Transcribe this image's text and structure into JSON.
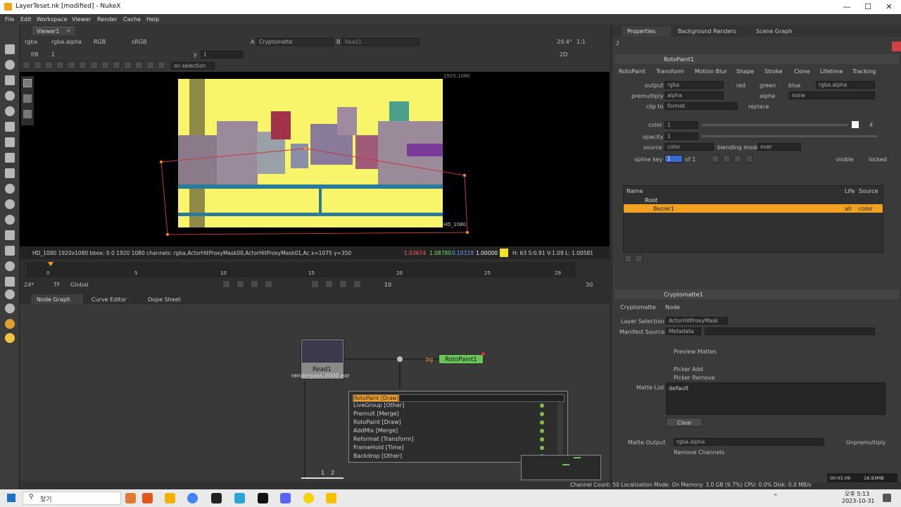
{
  "window": {
    "title": "LayerTeset.nk [modified] - NukeX"
  },
  "menu": [
    "File",
    "Edit",
    "Workspace",
    "Viewer",
    "Render",
    "Cache",
    "Help"
  ],
  "viewer": {
    "tab": "Viewer1",
    "channels": "rgba",
    "alpha": "rgba.alpha",
    "mode": "RGB",
    "lut": "sRGB",
    "input_a_label": "A",
    "input_a": "Cryptomatte",
    "input_b_label": "B",
    "input_b": "Read1",
    "zoom": "29.4°",
    "ratio": "1:1",
    "view_mode": "2D",
    "frame_field": "f/8",
    "frame_value": "1",
    "y_label": "y",
    "y_value": "1",
    "on_selection": "on selection",
    "resolution_label": "1920,1080",
    "format_label": "HD_1080",
    "info": "HD_1080 1920x1080  bbox: 0 0 1920 1080 channels: rgba,ActorHitProxyMask00,ActorHitProxyMask01,Ac  x=1075 y=350",
    "pixel_r": "1.03674",
    "pixel_g": "1.08780",
    "pixel_b": "0.10119",
    "pixel_a": "1.00000",
    "hsv": "H: 63 S:0.91 V:1.09  L: 1.00581"
  },
  "timeline": {
    "ticks": [
      "0",
      "5",
      "10",
      "15",
      "20",
      "25",
      "29"
    ],
    "fps": "24*",
    "tf": "TF",
    "scope": "Global",
    "step": "10",
    "end_frame": "30"
  },
  "bottom_tabs": [
    "Node Graph",
    "Curve Editor",
    "Dope Sheet"
  ],
  "nodegraph": {
    "read_node": "Read1",
    "read_file": "renderpass.0000.exr",
    "bg_label": "bg",
    "roto_node": "RotoPaint1",
    "search_text": "RotoPaint [Draw]",
    "results": [
      "LiveGroup [Other]",
      "Premult [Merge]",
      "RotoPaint [Draw]",
      "AddMix [Merge]",
      "Reformat [Transform]",
      "FrameHold [Time]",
      "Backdrop [Other]"
    ],
    "pipe_labels": [
      "1",
      "2"
    ]
  },
  "properties": {
    "tabs": [
      "Properties",
      "Background Renders",
      "Scene Graph"
    ],
    "max_panels": "2",
    "roto": {
      "name": "RotoPaint1",
      "tabs": [
        "RotoPaint",
        "Transform",
        "Motion Blur",
        "Shape",
        "Stroke",
        "Clone",
        "Lifetime",
        "Tracking"
      ],
      "output_label": "output",
      "output_value": "rgba",
      "ch_red": "red",
      "ch_green": "green",
      "ch_blue": "blue",
      "output_alpha": "rgba.alpha",
      "premultiply_label": "premultiply",
      "premultiply_value": "alpha",
      "premult_alpha": "alpha",
      "premult_none": "none",
      "clipto_label": "clip to",
      "clipto_value": "format",
      "replace": "replace",
      "color_label": "color",
      "color_value": "1",
      "color_channels": "4",
      "opacity_label": "opacity",
      "opacity_value": "1",
      "source_label": "source",
      "source_value": "color",
      "blending_label": "blending mode",
      "blending_value": "over",
      "splinekey_label": "spline key",
      "splinekey_value": "1",
      "splinekey_of": "of 1",
      "visible": "visible",
      "locked": "locked",
      "list_headers": [
        "Name",
        "Life",
        "Source"
      ],
      "layers": [
        {
          "name": "Root"
        },
        {
          "name": "Bezier1",
          "life": "all",
          "source": "color"
        }
      ]
    },
    "crypto": {
      "name": "Cryptomatte1",
      "tabs": [
        "Cryptomatte",
        "Node"
      ],
      "layer_label": "Layer Selection",
      "layer_value": "ActorHitProxyMask",
      "manifest_label": "Manifest Source",
      "manifest_value": "Metadata",
      "preview": "Preview Mattes",
      "picker_add": "Picker Add",
      "picker_remove": "Picker Remove",
      "matte_list_label": "Matte List",
      "matte_list_value": "default",
      "clear": "Clear",
      "matte_output_label": "Matte Output",
      "matte_output_value": "rgba.alpha",
      "unpremultiply": "Unpremultiply",
      "remove_channels": "Remove Channels"
    },
    "elapsed": "00:01:06",
    "memory_small": "16.93MB"
  },
  "statusbar": "Channel Count: 50  Localization Mode: On  Memory: 3.0 GB (9.7%)  CPU: 0.0%  Disk: 0.0 MB/s",
  "taskbar": {
    "search": "찾기",
    "time": "오후 5:13",
    "date": "2023-10-31"
  },
  "colors": {
    "roto_node": "#6cc55a",
    "selected_row": "#f0a020",
    "frame_bg": "#f8f56a"
  }
}
